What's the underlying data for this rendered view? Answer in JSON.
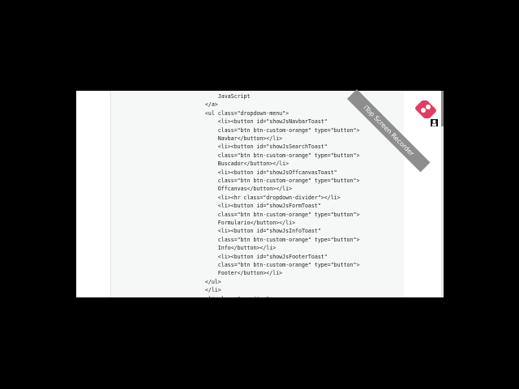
{
  "code": {
    "lines": [
      "        JavaScript",
      "    </a>",
      "    <ul class=\"dropdown-menu\">",
      "        <li><button id=\"showJsNavbarToast\"",
      "        class=\"btn btn-custom-orange\" type=\"button\">",
      "        Navbar</button></li>",
      "        <li><button id=\"showJsSearchToast\"",
      "        class=\"btn btn-custom-orange\" type=\"button\">",
      "        Buscador</button></li>",
      "        <li><button id=\"showJsOffcanvasToast\"",
      "        class=\"btn btn-custom-orange\" type=\"button\">",
      "        Offcanvas</button></li>",
      "        <li><hr class=\"dropdown-divider\"></li>",
      "        <li><button id=\"showJsFormToast\"",
      "        class=\"btn btn-custom-orange\" type=\"button\">",
      "        Formulario</button></li>",
      "        <li><button id=\"showJsInfoToast\"",
      "        class=\"btn btn-custom-orange\" type=\"button\">",
      "        Info</button></li>",
      "        <li><button id=\"showJsFooterToast\"",
      "        class=\"btn btn-custom-orange\" type=\"button\">",
      "        Footer</button></li>",
      "    </ul>",
      "    </li>",
      "    <li class=\"nav-item\">"
    ]
  },
  "watermark": {
    "text": "iTop Screen Recorder",
    "icon": "recorder-icon",
    "accent": "#e23c64"
  }
}
